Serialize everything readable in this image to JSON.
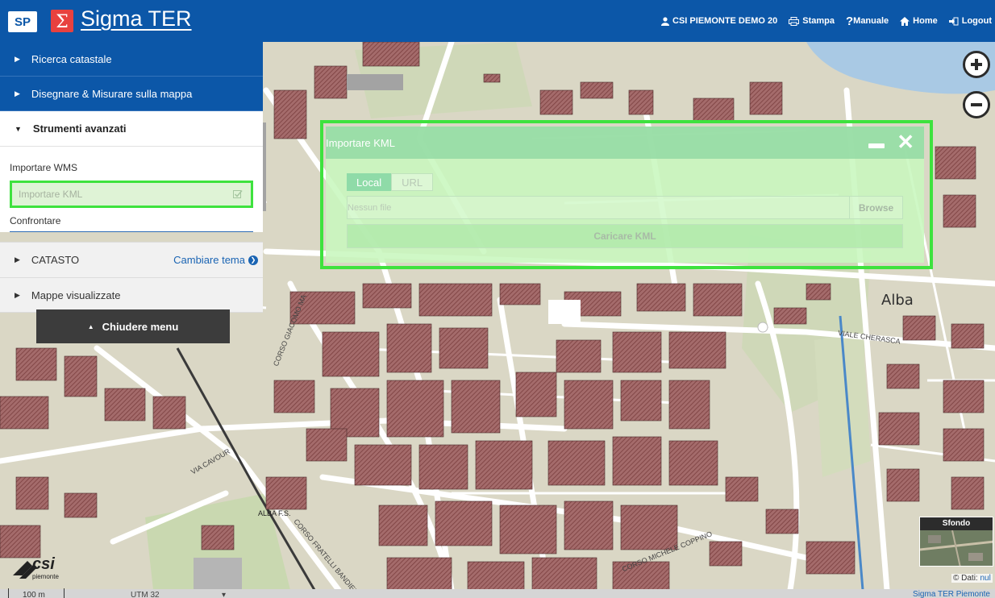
{
  "header": {
    "sp_logo": "SP",
    "title": "Sigma TER",
    "user": "CSI PIEMONTE DEMO 20",
    "print": "Stampa",
    "manual": "Manuale",
    "home": "Home",
    "logout": "Logout"
  },
  "sidebar": {
    "ricerca": "Ricerca catastale",
    "disegnare": "Disegnare & Misurare sulla mappa",
    "strumenti": "Strumenti avanzati",
    "sub_items": [
      "Importare WMS",
      "Importare KML",
      "Confrontare"
    ],
    "catasto": "CATASTO",
    "cambiare_tema": "Cambiare tema",
    "mappe": "Mappe visualizzate",
    "chiudere": "Chiudere menu"
  },
  "dialog": {
    "title": "Importare KML",
    "tab_local": "Local",
    "tab_url": "URL",
    "file_placeholder": "Nessun file",
    "browse": "Browse",
    "upload": "Caricare KML"
  },
  "map": {
    "town_label": "Alba",
    "street_labels": [
      "CORSO GIACOMO MA",
      "CORSO FRATELLI BANDIERA",
      "CORSO MICHELE COPPINO",
      "VIALE CHERASCA",
      "ALBA F.S.",
      "VIA CAVOUR"
    ]
  },
  "bottom": {
    "scale": "100 m",
    "projection": "UTM 32",
    "basemap": "Sfondo",
    "attribution": "© Dati: ",
    "attribution_link": "nul",
    "footer_link": "Sigma TER Piemonte",
    "csi_logo": "csi",
    "csi_logo_sub": "piemonte"
  },
  "colors": {
    "brand_blue": "#0c57a8",
    "highlight_green": "#3ee23e",
    "building": "#a46b6b"
  }
}
